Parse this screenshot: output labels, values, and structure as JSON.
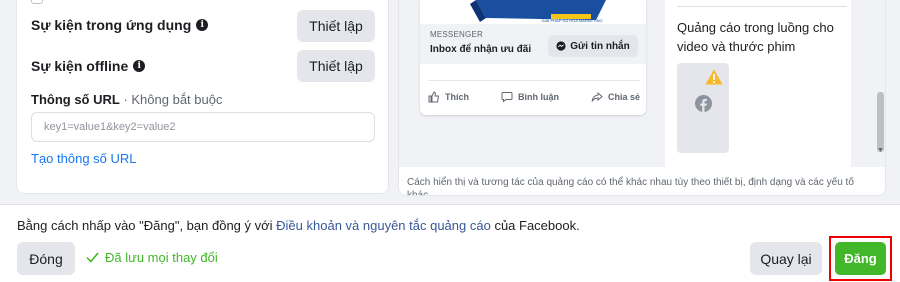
{
  "left": {
    "app_event": {
      "label": "Sự kiện trong ứng dụng",
      "button": "Thiết lập"
    },
    "offline_event": {
      "label": "Sự kiện offline",
      "button": "Thiết lập"
    },
    "url_params": {
      "label": "Thông số URL",
      "optional": " · Không bắt buộc",
      "placeholder": "key1=value1&key2=value2",
      "create_link": "Tạo thông số URL"
    }
  },
  "preview": {
    "product_banner": "GIẢI PHÁP SỐ HÓA MARKETING",
    "messenger_label": "MESSENGER",
    "inbox_text": "Inbox để nhận ưu đãi",
    "send_button": "Gửi tin nhắn",
    "actions": [
      "Thích",
      "Bình luận",
      "Chia sẻ"
    ],
    "instream_title": "Quảng cáo trong luồng cho video và thước phim",
    "disclaimer": "Cách hiển thị và tương tác của quảng cáo có thể khác nhau tùy theo thiết bị, định dạng và các yếu tố khác."
  },
  "footer": {
    "terms_prefix": "Bằng cách nhấp vào \"Đăng\", bạn đồng ý với ",
    "terms_link": "Điều khoản và nguyên tắc quảng cáo",
    "terms_suffix": " của Facebook.",
    "close_button": "Đóng",
    "saved_status": "Đã lưu mọi thay đổi",
    "back_button": "Quay lại",
    "publish_button": "Đăng"
  },
  "colors": {
    "accent_link": "#1876f2",
    "publish_green": "#42b72a",
    "highlight_red": "#e00000"
  },
  "icons": [
    "info-icon",
    "messenger-icon",
    "like-icon",
    "comment-icon",
    "share-icon",
    "warning-icon",
    "facebook-icon",
    "checkmark-icon"
  ]
}
